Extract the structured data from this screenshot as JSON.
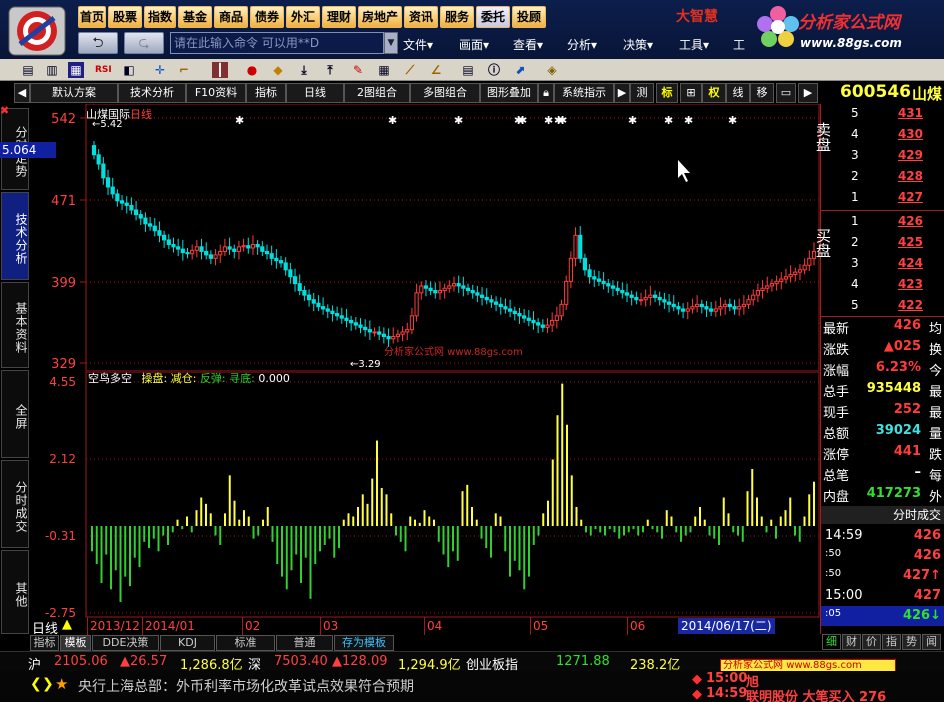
{
  "topnav": {
    "items": [
      "首页",
      "股票",
      "指数",
      "基金",
      "商品",
      "债券",
      "外汇",
      "理财",
      "房地产",
      "资讯",
      "服务",
      "委托",
      "投顾"
    ],
    "active_index": 11
  },
  "brand": {
    "app_name": "大智慧",
    "site_title": "分析家公式网",
    "site_url": "www.88gs.com"
  },
  "command": {
    "placeholder": "请在此输入命令  可以用**D"
  },
  "menubar": {
    "items": [
      "文件▾",
      "画面▾",
      "查看▾",
      "分析▾",
      "决策▾",
      "工具▾",
      "工"
    ]
  },
  "chart_toolbar": {
    "buttons": [
      "默认方案",
      "技术分析",
      "F10资料",
      "指标",
      "日线",
      "2图组合",
      "多图组合",
      "图形叠加",
      "系统指示"
    ],
    "small": [
      "测",
      "标",
      "权",
      "线",
      "移"
    ]
  },
  "stock": {
    "code": "600546",
    "name": "山煤",
    "full_name": "山煤国际",
    "period": "日线"
  },
  "left_tabs": [
    "分时走势",
    "技术分析",
    "基本资料",
    "全屏",
    "分时成交",
    "其他"
  ],
  "left_tabs_active": 1,
  "price_chart": {
    "y_ticks": [
      542,
      471,
      399,
      329
    ],
    "cursor_value": "5.064",
    "high_label": "5.42",
    "low_label": "3.29",
    "watermark": "分析家公式网  www.88gs.com"
  },
  "osc_chart": {
    "title": "空鸟多空",
    "legend": [
      "操盘:",
      "减仓:",
      "反弹:",
      "寻底:",
      "0.000"
    ],
    "y_ticks": [
      "4.55",
      "2.12",
      "-0.31",
      "-2.75"
    ]
  },
  "date_axis": {
    "period_label": "日线",
    "labels": [
      "2013/12",
      "2014/01",
      "02",
      "03",
      "04",
      "05",
      "06"
    ],
    "cursor_date": "2014/06/17(二)"
  },
  "bottom_tabs": [
    "指标",
    "模板",
    "DDE决策",
    "KDJ",
    "标准",
    "普通",
    "存为模板"
  ],
  "orderbook": {
    "sell_label": "卖盘",
    "buy_label": "买盘",
    "sell": [
      {
        "lvl": "5",
        "price": "431"
      },
      {
        "lvl": "4",
        "price": "430"
      },
      {
        "lvl": "3",
        "price": "429"
      },
      {
        "lvl": "2",
        "price": "428"
      },
      {
        "lvl": "1",
        "price": "427"
      }
    ],
    "buy": [
      {
        "lvl": "1",
        "price": "426"
      },
      {
        "lvl": "2",
        "price": "425"
      },
      {
        "lvl": "3",
        "price": "424"
      },
      {
        "lvl": "4",
        "price": "423"
      },
      {
        "lvl": "5",
        "price": "422"
      }
    ]
  },
  "quote_fields": [
    {
      "label": "最新",
      "value": "426",
      "r": "均",
      "cls": "red"
    },
    {
      "label": "涨跌",
      "value": "▲025",
      "r": "换",
      "cls": "red"
    },
    {
      "label": "涨幅",
      "value": "6.23%",
      "r": "今",
      "cls": "red"
    },
    {
      "label": "总手",
      "value": "935448",
      "r": "最",
      "cls": "yel"
    },
    {
      "label": "现手",
      "value": "252",
      "r": "最",
      "cls": "red"
    },
    {
      "label": "总额",
      "value": "39024",
      "r": "量",
      "cls": "cyn"
    },
    {
      "label": "涨停",
      "value": "441",
      "r": "跌",
      "cls": "red"
    },
    {
      "label": "总笔",
      "value": "–",
      "r": "每",
      "cls": "wht"
    },
    {
      "label": "内盘",
      "value": "417273",
      "r": "外",
      "cls": "grn"
    }
  ],
  "ticks_header": "分时成交",
  "ticks": [
    {
      "time": "14:59",
      "price": "426"
    },
    {
      "time": ":50",
      "price": "426"
    },
    {
      "time": ":50",
      "price": "427↑"
    },
    {
      "time": "15:00",
      "price": "427"
    },
    {
      "time": ":05",
      "price": "426↓"
    }
  ],
  "quote_tabs": [
    "细",
    "财",
    "价",
    "指",
    "势",
    "闻"
  ],
  "index_bar": {
    "sh_label": "沪",
    "sh_val": "2105.06",
    "sh_chg": "▲26.57",
    "sh_amt": "1,286.8亿",
    "sz_label": "深",
    "sz_val": "7503.40",
    "sz_chg": "▲128.09",
    "sz_amt": "1,294.9亿",
    "cy_label": "创业板指",
    "cy_val": "1271.88",
    "cy_amt": "238.2亿"
  },
  "news": {
    "text": "央行上海总部：外币利率市场化改革试点效果符合预期"
  },
  "alerts": [
    {
      "time": "15:00",
      "text": "旭"
    },
    {
      "time": "14:59",
      "text": "联明股份 大笔买入 276"
    }
  ],
  "colors": {
    "up": "#ff3c3c",
    "down": "#00e0e0",
    "osc_up": "#ffff40",
    "osc_down": "#30d030",
    "grid": "#a01818",
    "nav_active": "#2040c0"
  }
}
